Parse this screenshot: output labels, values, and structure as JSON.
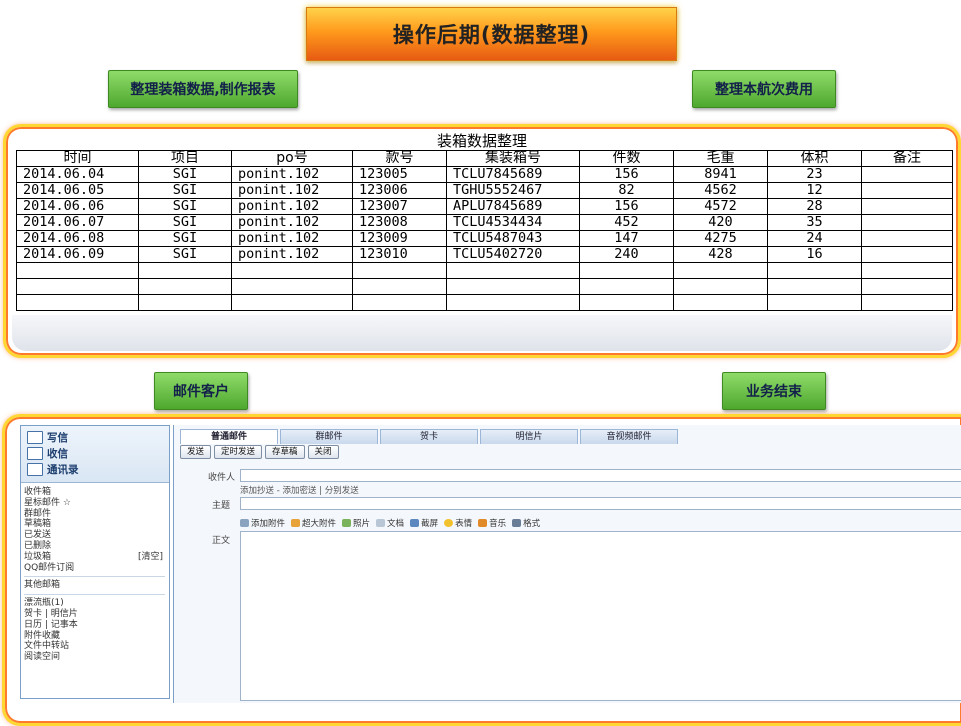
{
  "title": "操作后期(数据整理)",
  "labels": {
    "top_left": "整理装箱数据,制作报表",
    "top_right": "整理本航次费用",
    "bottom_left": "邮件客户",
    "bottom_right": "业务结束"
  },
  "table": {
    "title": "装箱数据整理",
    "headers": [
      "时间",
      "项目",
      "po号",
      "款号",
      "集装箱号",
      "件数",
      "毛重",
      "体积",
      "备注"
    ],
    "rows": [
      [
        "2014.06.04",
        "SGI",
        "ponint.102",
        "123005",
        "TCLU7845689",
        "156",
        "8941",
        "23",
        ""
      ],
      [
        "2014.06.05",
        "SGI",
        "ponint.102",
        "123006",
        "TGHU5552467",
        "82",
        "4562",
        "12",
        ""
      ],
      [
        "2014.06.06",
        "SGI",
        "ponint.102",
        "123007",
        "APLU7845689",
        "156",
        "4572",
        "28",
        ""
      ],
      [
        "2014.06.07",
        "SGI",
        "ponint.102",
        "123008",
        "TCLU4534434",
        "452",
        "420",
        "35",
        ""
      ],
      [
        "2014.06.08",
        "SGI",
        "ponint.102",
        "123009",
        "TCLU5487043",
        "147",
        "4275",
        "24",
        ""
      ],
      [
        "2014.06.09",
        "SGI",
        "ponint.102",
        "123010",
        "TCLU5402720",
        "240",
        "428",
        "16",
        ""
      ]
    ]
  },
  "mail": {
    "sidebar": {
      "compose": "写信",
      "receive": "收信",
      "contacts": "通讯录",
      "folders": [
        "收件箱",
        "星标邮件 ☆",
        "群邮件",
        "草稿箱",
        "已发送",
        "已删除",
        "垃圾箱",
        "QQ邮件订阅"
      ],
      "trash_clear": "[清空]",
      "other_mailbox": "其他邮箱",
      "extras": [
        "漂流瓶(1)",
        "贺卡 | 明信片",
        "日历 | 记事本",
        "附件收藏",
        "文件中转站",
        "阅读空间"
      ]
    },
    "tabs": [
      "普通邮件",
      "群邮件",
      "贺卡",
      "明信片",
      "音视频邮件"
    ],
    "toolbar": [
      "发送",
      "定时发送",
      "存草稿",
      "关闭"
    ],
    "fields": {
      "to_label": "收件人",
      "cc_hint": "添加抄送 - 添加密送 | 分别发送",
      "subject_label": "主题",
      "body_label": "正文"
    },
    "format_bar": [
      "添加附件",
      "超大附件",
      "照片",
      "文档",
      "截屏",
      "表情",
      "音乐",
      "格式"
    ]
  }
}
